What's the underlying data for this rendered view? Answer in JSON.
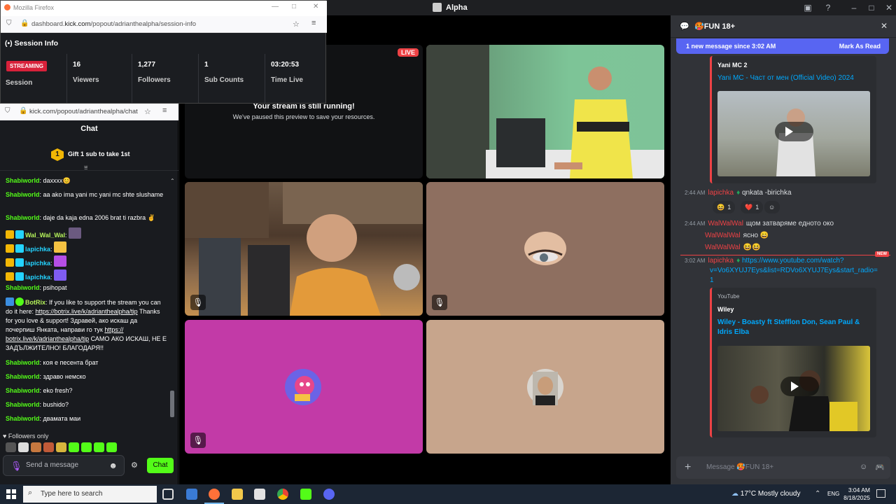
{
  "discord": {
    "window_title": "Alpha",
    "channel_name": "🥵FUN 18+",
    "new_messages_banner": "1 new message since 3:02 AM",
    "mark_as_read": "Mark As Read",
    "message_placeholder": "Message 🥵FUN 18+",
    "stream_tile": {
      "live_badge": "LIVE",
      "title": "Your stream is still running!",
      "subtitle": "We've paused this preview to save your resources."
    },
    "chat": {
      "embed1": {
        "author": "Yani MC 2",
        "title": "Yani MC - Част от мен (Official Video) 2024"
      },
      "msg1": {
        "time": "2:44 AM",
        "user": "lapichka",
        "text": "qnkata -birichka"
      },
      "reactions1": [
        {
          "emoji": "😆",
          "count": "1"
        },
        {
          "emoji": "❤️",
          "count": "1"
        }
      ],
      "msg2": {
        "time": "2:44 AM",
        "user": "WalWalWal",
        "text": "щом затваряме едното око"
      },
      "msg3": {
        "user": "WalWalWal",
        "text": "ясно 😄"
      },
      "msg4": {
        "user": "WalWalWal",
        "text": "😆😆"
      },
      "new_tag": "NEW",
      "msg5": {
        "time": "3:02 AM",
        "user": "lapichka",
        "link1": "https://www.youtube.com/watch?",
        "link2": "v=Vo6XYUJ7Eys&list=RDVo6XYUJ7Eys&start_radio=",
        "link3": "1"
      },
      "embed2": {
        "provider": "YouTube",
        "author": "Wiley",
        "title1": "Wiley - Boasty ft  Stefflon Don, Sean Paul &",
        "title2": "Idris Elba"
      }
    }
  },
  "firefox": {
    "title": "Mozilla Firefox",
    "url_prefix": "dashboard.",
    "url_domain": "kick.com",
    "url_path": "/popout/adrianthealpha/session-info",
    "session_heading": "Session Info",
    "status_badge": "STREAMING",
    "session_label": "Session",
    "stats": [
      {
        "value": "16",
        "label": "Viewers"
      },
      {
        "value": "1,277",
        "label": "Followers"
      },
      {
        "value": "1",
        "label": "Sub Counts"
      },
      {
        "value": "03:20:53",
        "label": "Time Live"
      }
    ]
  },
  "kick": {
    "url": "kick.com/popout/adrianthealpha/chat",
    "chat_heading": "Chat",
    "gift_badge": "1",
    "gift_text": "Gift 1 sub to take 1st",
    "messages": [
      {
        "user": "Shabiworld",
        "text": " daxxxx😊"
      },
      {
        "user": "Shabiworld",
        "text": " aa ako ima yani mc yani mc shte slushame"
      },
      {
        "user": "Shabiworld",
        "text": " daje da kaja edna 2006 brat ti razbra ✌"
      },
      {
        "user": "Wal_Wal_Wal",
        "text": ":"
      },
      {
        "user": "lapichka",
        "text": ":"
      },
      {
        "user": "lapichka",
        "text": ":"
      },
      {
        "user": "lapichka",
        "text": ":"
      },
      {
        "user": "Shabiworld",
        "text": " psihopat"
      },
      {
        "user": "BotRix",
        "text": " If you like to support the stream you can do it here: ",
        "link1": "https://botrix.live/k/adrianthealpha/tip",
        "text2": " Thanks for you love & support! Здравей, ако искаш да почерпиш Янката, направи го тук ",
        "link2": "https:// botrix.live/k/adrianthealpha/tip",
        "text3": " САМО АКО ИСКАШ, НЕ Е ЗАДЪЛЖИТЕЛНО! БЛАГОДАРЯ!!"
      },
      {
        "user": "Shabiworld",
        "text": " коя е песента брат"
      },
      {
        "user": "Shabiworld",
        "text": " здраво немско"
      },
      {
        "user": "Shabiworld",
        "text": " eko fresh?"
      },
      {
        "user": "Shabiworld",
        "text": " bushido?"
      },
      {
        "user": "Shabiworld",
        "text": " двамата маи"
      }
    ],
    "followers_only": "♥ Followers only",
    "input_placeholder": "Send a message",
    "send_label": "Chat"
  },
  "taskbar": {
    "search_placeholder": "Type here to search",
    "weather": "17°C  Mostly cloudy",
    "language": "ENG",
    "time": "3:04 AM",
    "date": "8/18/2025"
  },
  "colors": {
    "discord_bg": "#313338",
    "kick_green": "#53fc18",
    "blurple": "#5865f2",
    "live_red": "#ed4245",
    "streaming_red": "#d8213a"
  }
}
